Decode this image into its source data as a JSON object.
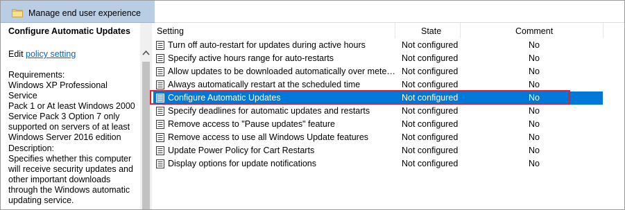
{
  "window": {
    "title": "Manage end user experience"
  },
  "left_pane": {
    "heading": "Configure Automatic Updates",
    "edit_prefix": "Edit ",
    "edit_link": "policy setting ",
    "requirements_label": "Requirements:",
    "requirements_text": "Windows XP Professional Service\nPack 1 or At least Windows 2000\nService Pack 3 Option 7 only\nsupported on servers of at least\nWindows Server 2016 edition",
    "description_label": "Description:",
    "description_text": "Specifies whether this computer\nwill receive security updates and\nother important downloads\nthrough the Windows automatic\nupdating service."
  },
  "table": {
    "columns": {
      "setting": "Setting",
      "state": "State",
      "comment": "Comment"
    },
    "rows": [
      {
        "setting": "Turn off auto-restart for updates during active hours",
        "state": "Not configured",
        "comment": "No"
      },
      {
        "setting": "Specify active hours range for auto-restarts",
        "state": "Not configured",
        "comment": "No"
      },
      {
        "setting": "Allow updates to be downloaded automatically over metered connections",
        "state": "Not configured",
        "comment": "No"
      },
      {
        "setting": "Always automatically restart at the scheduled time",
        "state": "Not configured",
        "comment": "No"
      },
      {
        "setting": "Configure Automatic Updates",
        "state": "Not configured",
        "comment": "No",
        "selected": true
      },
      {
        "setting": "Specify deadlines for automatic updates and restarts",
        "state": "Not configured",
        "comment": "No"
      },
      {
        "setting": "Remove access to \"Pause updates\" feature",
        "state": "Not configured",
        "comment": "No"
      },
      {
        "setting": "Remove access to use all Windows Update features",
        "state": "Not configured",
        "comment": "No"
      },
      {
        "setting": "Update Power Policy for Cart Restarts",
        "state": "Not configured",
        "comment": "No"
      },
      {
        "setting": "Display options for update notifications",
        "state": "Not configured",
        "comment": "No"
      }
    ]
  },
  "colors": {
    "title_band": "#b9cde5",
    "selection": "#0078d7",
    "highlight_border": "#e0202a",
    "link": "#0066cc"
  },
  "icons": {
    "title": "folder-icon",
    "row": "policy-setting-icon",
    "scroll_up": "chevron-up-icon"
  }
}
